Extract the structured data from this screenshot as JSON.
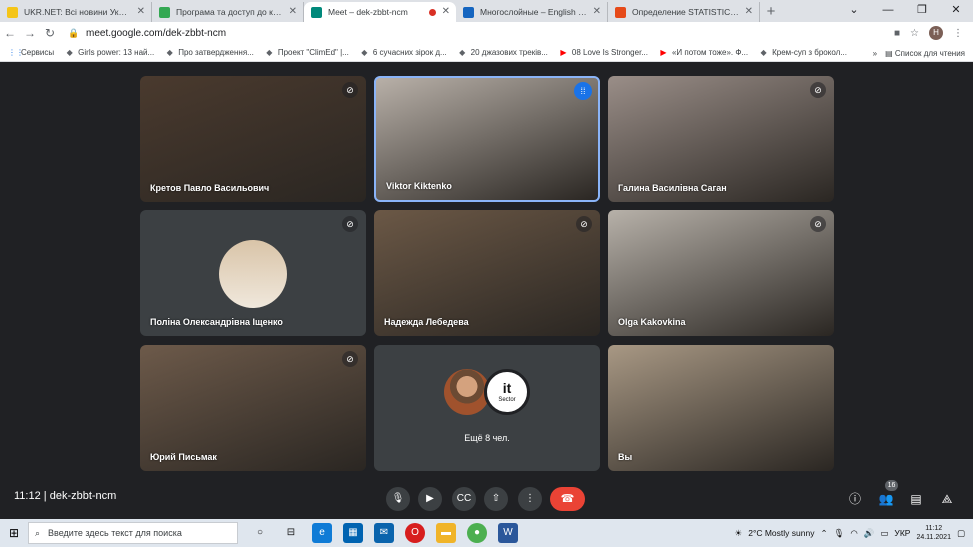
{
  "browser": {
    "tabs": [
      {
        "title": "UKR.NET: Всі новини України, о",
        "favicon_color": "#f5c518",
        "active": false
      },
      {
        "title": "Програма та доступ до конфер",
        "favicon_color": "#34a853",
        "active": false
      },
      {
        "title": "Meet – dek-zbbt-ncm",
        "favicon_color": "#00897b",
        "active": true,
        "recording": true
      },
      {
        "title": "Многослойные – English transla",
        "favicon_color": "#1565c0",
        "active": false
      },
      {
        "title": "Определение STATISTIC в кемб",
        "favicon_color": "#e64a19",
        "active": false
      }
    ],
    "new_tab": "+",
    "url": "meet.google.com/dek-zbbt-ncm",
    "profile_initial": "Н",
    "bookmarks": [
      {
        "label": "Сервисы",
        "icon": "apps-grid-icon"
      },
      {
        "label": "Girls power: 13 най...",
        "icon": "bookmark-icon"
      },
      {
        "label": "Про затвердження...",
        "icon": "bookmark-icon"
      },
      {
        "label": "Проект \"ClimEd\" |...",
        "icon": "bookmark-icon"
      },
      {
        "label": "6 сучасних зірок д...",
        "icon": "bookmark-icon"
      },
      {
        "label": "20 джазових треків...",
        "icon": "bookmark-icon"
      },
      {
        "label": "08 Love Is Stronger...",
        "icon": "youtube-icon"
      },
      {
        "label": "«И потом тоже». Ф...",
        "icon": "youtube-icon"
      },
      {
        "label": "Крем-суп з брокол...",
        "icon": "bookmark-icon"
      }
    ],
    "bookmarks_more": "»",
    "reading_list": "Список для чтения"
  },
  "meet": {
    "participants": [
      {
        "name": "Кретов Павло Васильович",
        "muted": true,
        "bg": "#4a3a2e"
      },
      {
        "name": "Viktor Kiktenko",
        "muted": false,
        "speaking": true,
        "bg": "#b8b0a8"
      },
      {
        "name": "Галина Василівна Саган",
        "muted": true,
        "bg": "#9a8e88"
      },
      {
        "name": "Поліна Олександрівна Іщенко",
        "muted": true,
        "avatar_only": true,
        "bg": "#3c4043"
      },
      {
        "name": "Надежда Лебедева",
        "muted": true,
        "bg": "#6b5846"
      },
      {
        "name": "Olga Kakovkina",
        "muted": true,
        "bg": "#b7b1a9"
      },
      {
        "name": "Юрий Письмак",
        "muted": true,
        "bg": "#6d5a4a"
      },
      {
        "name": "Вы",
        "muted": false,
        "bg": "#a89884"
      }
    ],
    "more_label": "Ещё 8 чел.",
    "more_avatar_text": {
      "line1": "it",
      "line2": "Sector"
    },
    "clock": "11:12",
    "meeting_code": "dek-zbbt-ncm",
    "participants_count": "16"
  },
  "taskbar": {
    "search_placeholder": "Введите здесь текст для поиска",
    "weather": "2°C  Mostly sunny",
    "lang": "УКР",
    "time": "11:12",
    "date": "24.11.2021"
  }
}
